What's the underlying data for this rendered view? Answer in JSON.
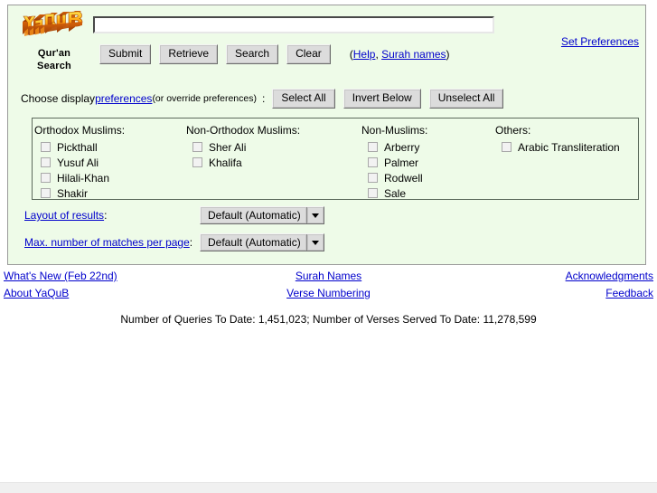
{
  "logo": {
    "wordmark": "YaQuB",
    "caption_line1": "Qur'an",
    "caption_line2": "Search",
    "colors": {
      "highlight": "#ffd000",
      "mid": "#f07a10",
      "shadow": "#b34a06"
    }
  },
  "search": {
    "value": "",
    "placeholder": ""
  },
  "buttons": {
    "submit": "Submit",
    "retrieve": "Retrieve",
    "search": "Search",
    "clear": "Clear"
  },
  "help_note": {
    "open_paren": "(",
    "help": "Help",
    "comma": ", ",
    "surah_names": "Surah names",
    "close_paren": ")"
  },
  "set_preferences": "Set Preferences",
  "choose_display": {
    "lead": "Choose display ",
    "preferences_link": "preferences",
    "note": " (or override preferences)",
    "colon": ":",
    "select_all": "Select All",
    "invert_below": "Invert Below",
    "unselect_all": "Unselect All"
  },
  "groups": [
    {
      "title": "Orthodox Muslims:",
      "items": [
        {
          "label": "Pickthall",
          "checked": false
        },
        {
          "label": "Yusuf Ali",
          "checked": false
        },
        {
          "label": "Hilali-Khan",
          "checked": false
        },
        {
          "label": "Shakir",
          "checked": false
        }
      ]
    },
    {
      "title": "Non-Orthodox Muslims:",
      "items": [
        {
          "label": "Sher Ali",
          "checked": false
        },
        {
          "label": "Khalifa",
          "checked": false
        }
      ]
    },
    {
      "title": "Non-Muslims:",
      "items": [
        {
          "label": "Arberry",
          "checked": false
        },
        {
          "label": "Palmer",
          "checked": false
        },
        {
          "label": "Rodwell",
          "checked": false
        },
        {
          "label": "Sale",
          "checked": false
        }
      ]
    },
    {
      "title": "Others:",
      "items": [
        {
          "label": "Arabic Transliteration",
          "checked": false
        }
      ]
    }
  ],
  "selects": {
    "layout": {
      "label": "Layout of results",
      "colon": ":",
      "value": "Default (Automatic)"
    },
    "matches": {
      "label": "Max. number of matches per page",
      "colon": ":",
      "value": "Default (Automatic)"
    }
  },
  "footer": {
    "whats_new": "What's New (Feb 22nd)",
    "surah_names": "Surah Names",
    "acknowledgments": "Acknowledgments",
    "about": "About YaQuB",
    "verse_numbering": "Verse Numbering",
    "feedback": "Feedback"
  },
  "stats": "Number of Queries To Date: 1,451,023; Number of Verses Served To Date: 11,278,599"
}
